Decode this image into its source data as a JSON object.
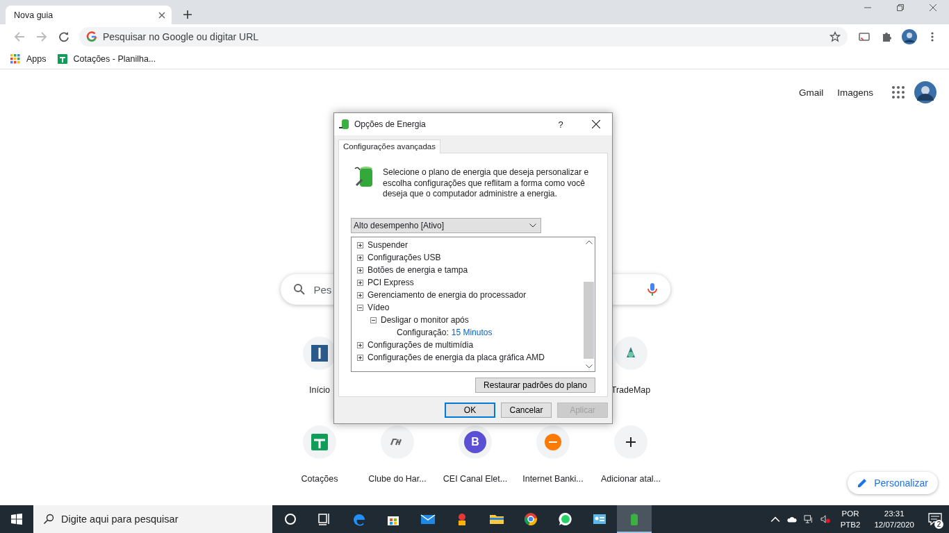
{
  "browser": {
    "tab": {
      "title": "Nova guia"
    },
    "omnibox": {
      "placeholder": "Pesquisar no Google ou digitar URL"
    },
    "bookmarks": [
      {
        "kind": "apps",
        "label": "Apps"
      },
      {
        "kind": "sheet",
        "label": "Cotações - Planilha..."
      }
    ]
  },
  "new_tab_page": {
    "top_links": [
      "Gmail",
      "Imagens"
    ],
    "search": {
      "placeholder": "Pes"
    },
    "shortcuts_row_1": [
      {
        "kind": "square",
        "label": "Início"
      },
      {
        "kind": "trade",
        "label": "TradeMap"
      }
    ],
    "shortcuts_row_2": [
      {
        "kind": "sheet",
        "label": "Cotações"
      },
      {
        "kind": "ch",
        "label": "Clube do Har..."
      },
      {
        "kind": "letter",
        "letter": "B",
        "label": "CEI Canal Elet..."
      },
      {
        "kind": "inter",
        "label": "Internet Banki..."
      },
      {
        "kind": "add",
        "label": "Adicionar atal..."
      }
    ],
    "customize": "Personalizar"
  },
  "dialog": {
    "title": "Opções de Energia",
    "help": "?",
    "tabs": [
      {
        "label": "Configurações avançadas",
        "selected": true
      }
    ],
    "description": "Selecione o plano de energia que deseja personalizar e escolha configurações que reflitam a forma como você deseja que o computador administre a energia.",
    "plan": "Alto desempenho [Ativo]",
    "tree": [
      {
        "label": "Suspender",
        "expanded": false
      },
      {
        "label": "Configurações USB",
        "expanded": false
      },
      {
        "label": "Botões de energia e tampa",
        "expanded": false
      },
      {
        "label": "PCI Express",
        "expanded": false
      },
      {
        "label": "Gerenciamento de energia do processador",
        "expanded": false
      },
      {
        "label": "Vídeo",
        "expanded": true,
        "children": [
          {
            "label": "Desligar o monitor após",
            "expanded": true,
            "children": [
              {
                "kind": "setting",
                "label": "Configuração:",
                "value": "15 Minutos"
              }
            ]
          }
        ]
      },
      {
        "label": "Configurações de multimídia",
        "expanded": false
      },
      {
        "label": "Configurações de energia da placa gráfica AMD",
        "expanded": false
      }
    ],
    "restore_button": "Restaurar padrões do plano",
    "buttons": [
      {
        "label": "OK",
        "default": true,
        "disabled": false
      },
      {
        "label": "Cancelar",
        "default": false,
        "disabled": false
      },
      {
        "label": "Aplicar",
        "default": false,
        "disabled": true
      }
    ]
  },
  "taskbar": {
    "search": {
      "placeholder": "Digite aqui para pesquisar"
    },
    "apps": [
      {
        "kind": "cortana",
        "active": false
      },
      {
        "kind": "taskview",
        "active": false
      },
      {
        "kind": "edge",
        "active": false
      },
      {
        "kind": "store",
        "active": false
      },
      {
        "kind": "mail",
        "active": false
      },
      {
        "kind": "game",
        "active": false
      },
      {
        "kind": "explorer",
        "active": false
      },
      {
        "kind": "chrome",
        "active": false
      },
      {
        "kind": "whatsapp",
        "active": false
      },
      {
        "kind": "contacts",
        "active": false
      },
      {
        "kind": "battery",
        "active": true
      }
    ],
    "language": [
      "POR",
      "PTB2"
    ],
    "time": "23:31",
    "date": "12/07/2020",
    "notifications": "2"
  }
}
